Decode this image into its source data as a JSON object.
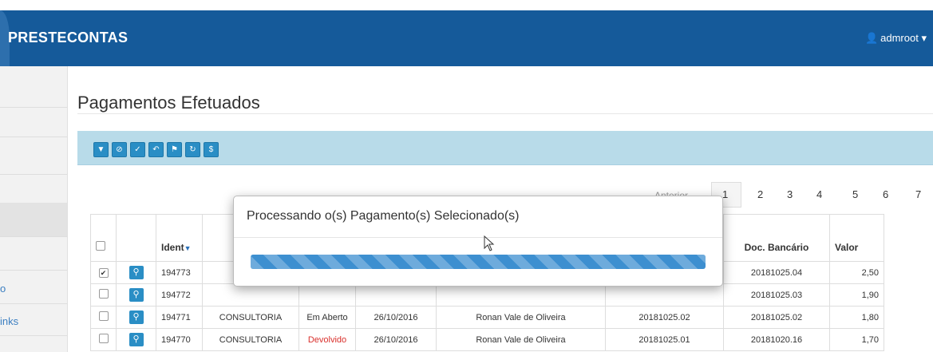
{
  "header": {
    "brand": "PRESTECONTAS",
    "user": "admroot",
    "user_icon": "user-icon",
    "caret": "▾"
  },
  "sidebar": {
    "collapse_icon": "chevron-left-icon",
    "partial_items": [
      "o",
      "inks"
    ]
  },
  "page": {
    "title": "Pagamentos Efetuados"
  },
  "toolbar": {
    "buttons": [
      "filter-icon",
      "unlink-icon",
      "check-icon",
      "undo-icon",
      "flag-icon",
      "refresh-icon",
      "dollar-icon"
    ]
  },
  "pager": {
    "prev": "Anterior",
    "pages": [
      "1",
      "2",
      "3",
      "4",
      "5",
      "6",
      "7"
    ],
    "active": "1"
  },
  "table": {
    "headers": {
      "ident": "Ident",
      "doc_bancario": "Doc. Bancário",
      "valor": "Valor"
    },
    "rows": [
      {
        "checked": true,
        "ident": "194773",
        "tipo": "",
        "situacao": "",
        "data": "",
        "nome": "",
        "doc": "",
        "doc_bancario": "20181025.04",
        "valor": "2,50"
      },
      {
        "checked": false,
        "ident": "194772",
        "tipo": "",
        "situacao": "",
        "data": "",
        "nome": "",
        "doc": "",
        "doc_bancario": "20181025.03",
        "valor": "1,90"
      },
      {
        "checked": false,
        "ident": "194771",
        "tipo": "CONSULTORIA",
        "situacao": "Em Aberto",
        "data": "26/10/2016",
        "nome": "Ronan Vale de Oliveira",
        "doc": "20181025.02",
        "doc_bancario": "20181025.02",
        "valor": "1,80"
      },
      {
        "checked": false,
        "ident": "194770",
        "tipo": "CONSULTORIA",
        "situacao": "Devolvido",
        "data": "26/10/2016",
        "nome": "Ronan Vale de Oliveira",
        "doc": "20181025.01",
        "doc_bancario": "20181020.16",
        "valor": "1,70"
      }
    ]
  },
  "modal": {
    "title": "Processando o(s) Pagamento(s) Selecionado(s)",
    "progress": 1.0
  },
  "colors": {
    "topbar": "#155a9a",
    "accent": "#2a8ec5",
    "danger": "#d9302c"
  }
}
